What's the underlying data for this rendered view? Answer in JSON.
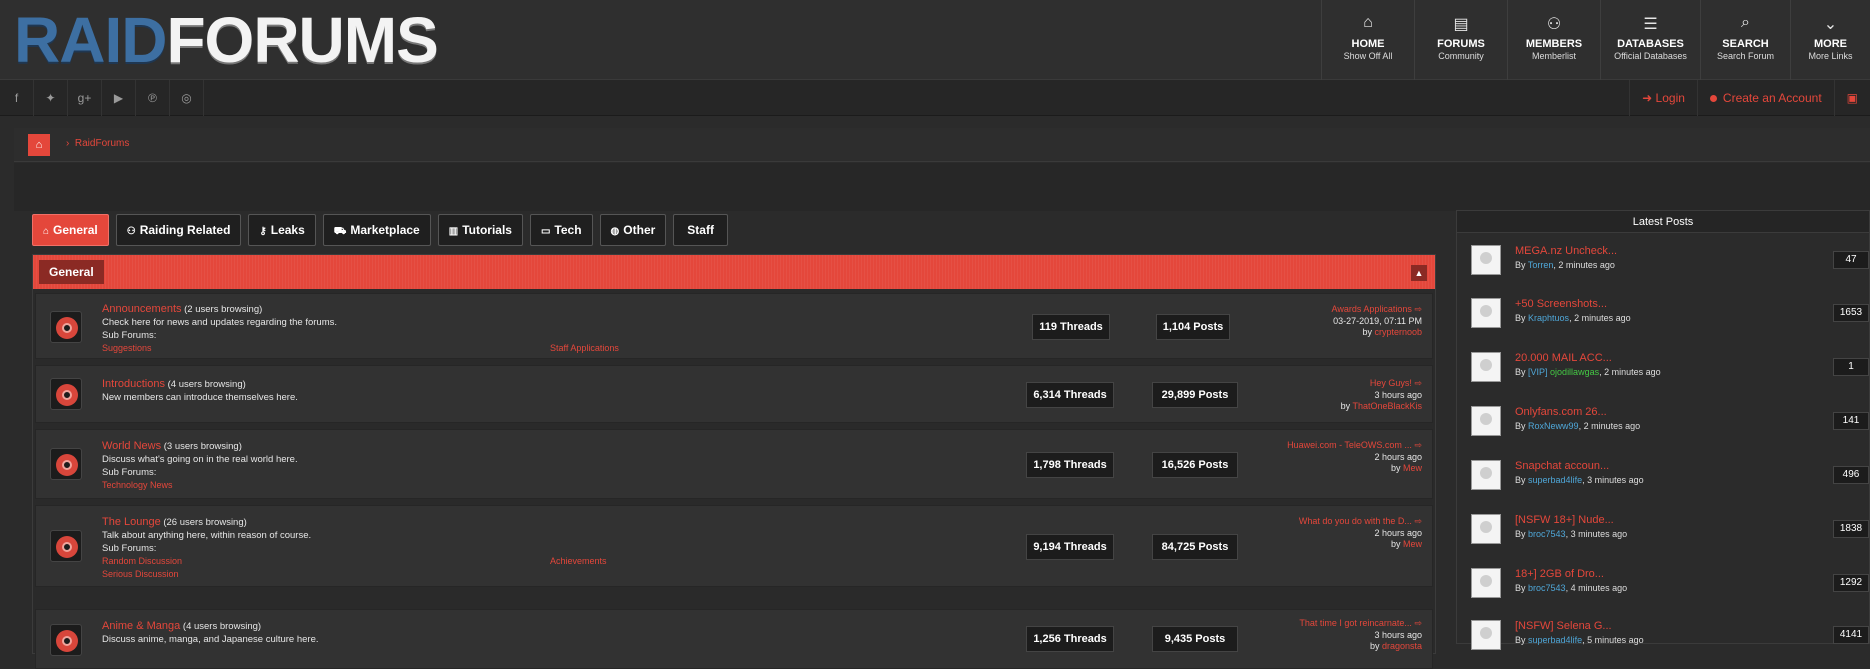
{
  "header": {
    "logo": {
      "part1": "RAID",
      "part2": "FORUMS"
    },
    "nav": [
      {
        "icon": "home-icon",
        "glyph": "⌂",
        "title": "HOME",
        "sub": "Show Off All"
      },
      {
        "icon": "file-icon",
        "glyph": "▤",
        "title": "FORUMS",
        "sub": "Community"
      },
      {
        "icon": "users-icon",
        "glyph": "⚇",
        "title": "MEMBERS",
        "sub": "Memberlist"
      },
      {
        "icon": "database-icon",
        "glyph": "☰",
        "title": "DATABASES",
        "sub": "Official Databases"
      },
      {
        "icon": "search-icon",
        "glyph": "⌕",
        "title": "SEARCH",
        "sub": "Search Forum"
      },
      {
        "icon": "chevron-down-icon",
        "glyph": "⌄",
        "title": "MORE",
        "sub": "More Links"
      }
    ]
  },
  "social": {
    "icons": [
      {
        "name": "facebook-icon",
        "glyph": "f"
      },
      {
        "name": "twitter-icon",
        "glyph": "✦"
      },
      {
        "name": "google-plus-icon",
        "glyph": "g+"
      },
      {
        "name": "youtube-icon",
        "glyph": "▶"
      },
      {
        "name": "pinterest-icon",
        "glyph": "℗"
      },
      {
        "name": "dribbble-icon",
        "glyph": "◎"
      }
    ],
    "login": "Login",
    "create_account": "Create an Account"
  },
  "breadcrumb": {
    "current": "RaidForums"
  },
  "tabs": [
    {
      "label": "General",
      "icon": "home-icon",
      "glyph": "⌂",
      "active": true
    },
    {
      "label": "Raiding Related",
      "icon": "users-icon",
      "glyph": "⚇"
    },
    {
      "label": "Leaks",
      "icon": "unlock-icon",
      "glyph": "⚷"
    },
    {
      "label": "Marketplace",
      "icon": "cart-icon",
      "glyph": "⛟"
    },
    {
      "label": "Tutorials",
      "icon": "book-icon",
      "glyph": "▥"
    },
    {
      "label": "Tech",
      "icon": "laptop-icon",
      "glyph": "▭"
    },
    {
      "label": "Other",
      "icon": "globe-icon",
      "glyph": "◍"
    },
    {
      "label": "Staff",
      "icon": "",
      "glyph": ""
    }
  ],
  "category": {
    "title": "General",
    "collapse_glyph": "▲"
  },
  "forums": [
    {
      "name": "Announcements",
      "browsing": "(2 users browsing)",
      "desc": "Check here for news and updates regarding the forums.",
      "subforums_label": "Sub Forums:",
      "subs": [
        "Suggestions",
        "Staff Applications"
      ],
      "threads": "119 Threads",
      "posts": "1,104 Posts",
      "last_title": "Awards Applications",
      "last_time": "03-27-2019, 07:11 PM",
      "last_by_prefix": "by",
      "last_by": "crypternoob"
    },
    {
      "name": "Introductions",
      "browsing": "(4 users browsing)",
      "desc": "New members can introduce themselves here.",
      "threads": "6,314 Threads",
      "posts": "29,899 Posts",
      "last_title": "Hey Guys!",
      "last_time": "3 hours ago",
      "last_by_prefix": "by",
      "last_by": "ThatOneBlackKis"
    },
    {
      "name": "World News",
      "browsing": "(3 users browsing)",
      "desc": "Discuss what's going on in the real world here.",
      "subforums_label": "Sub Forums:",
      "subs": [
        "Technology News"
      ],
      "threads": "1,798 Threads",
      "posts": "16,526 Posts",
      "last_title": "Huawei.com - TeleOWS.com ...",
      "last_time": "2 hours ago",
      "last_by_prefix": "by",
      "last_by": "Mew"
    },
    {
      "name": "The Lounge",
      "browsing": "(26 users browsing)",
      "desc": "Talk about anything here, within reason of course.",
      "subforums_label": "Sub Forums:",
      "subs": [
        "Random Discussion",
        "Achievements",
        "Serious Discussion"
      ],
      "threads": "9,194 Threads",
      "posts": "84,725 Posts",
      "last_title": "What do you do with the D...",
      "last_time": "2 hours ago",
      "last_by_prefix": "by",
      "last_by": "Mew"
    },
    {
      "name": "Anime & Manga",
      "browsing": "(4 users browsing)",
      "desc": "Discuss anime, manga, and Japanese culture here.",
      "threads": "1,256 Threads",
      "posts": "9,435 Posts",
      "last_title": "That time I got reincarnate...",
      "last_time": "3 hours ago",
      "last_by_prefix": "by",
      "last_by": "dragonsta"
    }
  ],
  "latest": {
    "title": "Latest Posts",
    "posts": [
      {
        "title": "MEGA.nz Uncheck...",
        "by": "By",
        "user": "Torren",
        "time": ", 2 minutes ago",
        "count": "47"
      },
      {
        "title": "+50 Screenshots...",
        "by": "By",
        "user": "Kraphtuos",
        "time": ", 2 minutes ago",
        "count": "1653"
      },
      {
        "title": "20.000 MAIL ACC...",
        "by": "By",
        "user_prefix": "[VIP] ",
        "user": "ojodillawgas",
        "time": ", 2 minutes ago",
        "count": "1"
      },
      {
        "title": "Onlyfans.com 26...",
        "by": "By",
        "user": "RoxNeww99",
        "time": ", 2 minutes ago",
        "count": "141"
      },
      {
        "title": "Snapchat accoun...",
        "by": "By",
        "user": "superbad4life",
        "time": ", 3 minutes ago",
        "count": "496"
      },
      {
        "title": "[NSFW 18+] Nude...",
        "by": "By",
        "user": "broc7543",
        "time": ", 3 minutes ago",
        "count": "1838"
      },
      {
        "title": "18+] 2GB of Dro...",
        "by": "By",
        "user": "broc7543",
        "time": ", 4 minutes ago",
        "count": "1292"
      },
      {
        "title": "[NSFW] Selena G...",
        "by": "By",
        "user": "superbad4life",
        "time": ", 5 minutes ago",
        "count": "4141"
      }
    ]
  },
  "colors": {
    "accent": "#e4473b",
    "background": "#2b2b2b",
    "raid_blue": "#3d6fa2"
  }
}
